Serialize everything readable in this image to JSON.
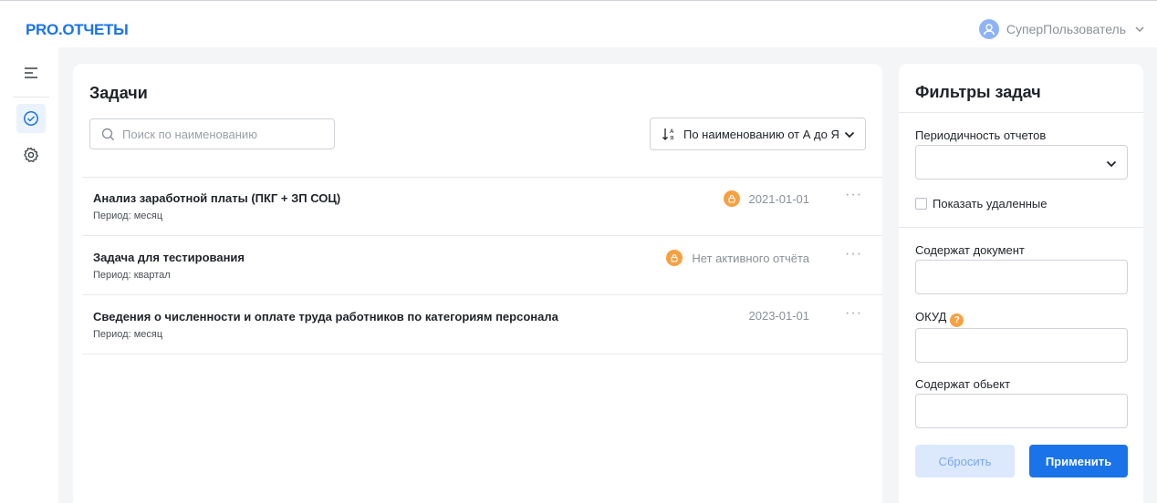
{
  "header": {
    "logo": "PRO.ОТЧЕТЫ",
    "user_name": "СуперПользователь"
  },
  "sidebar": {
    "items": [
      {
        "icon": "menu-icon"
      },
      {
        "icon": "check-circle-icon",
        "active": true
      },
      {
        "icon": "gear-icon"
      }
    ]
  },
  "tasks": {
    "title": "Задачи",
    "search_placeholder": "Поиск по наименованию",
    "sort_label": "По наименованию от А до Я",
    "rows": [
      {
        "name": "Анализ заработной платы (ПКГ + ЗП СОЦ)",
        "period": "Период: месяц",
        "status": "2021-01-01",
        "locked": true,
        "more": "···"
      },
      {
        "name": "Задача для тестирования",
        "period": "Период: квартал",
        "status": "Нет активного отчёта",
        "locked": true,
        "more": "···"
      },
      {
        "name": "Сведения о численности и оплате труда работников по категориям персонала",
        "period": "Период: месяц",
        "status": "2023-01-01",
        "locked": false,
        "more": "···"
      }
    ]
  },
  "filters": {
    "title": "Фильтры задач",
    "periodicity_label": "Периодичность отчетов",
    "show_deleted_label": "Показать удаленные",
    "document_label": "Содержат документ",
    "okud_label": "ОКУД",
    "okud_hint": "?",
    "object_label": "Содержат обьект",
    "reset_label": "Сбросить",
    "apply_label": "Применить"
  },
  "colors": {
    "accent": "#1a73e8",
    "lock": "#f5a142"
  }
}
